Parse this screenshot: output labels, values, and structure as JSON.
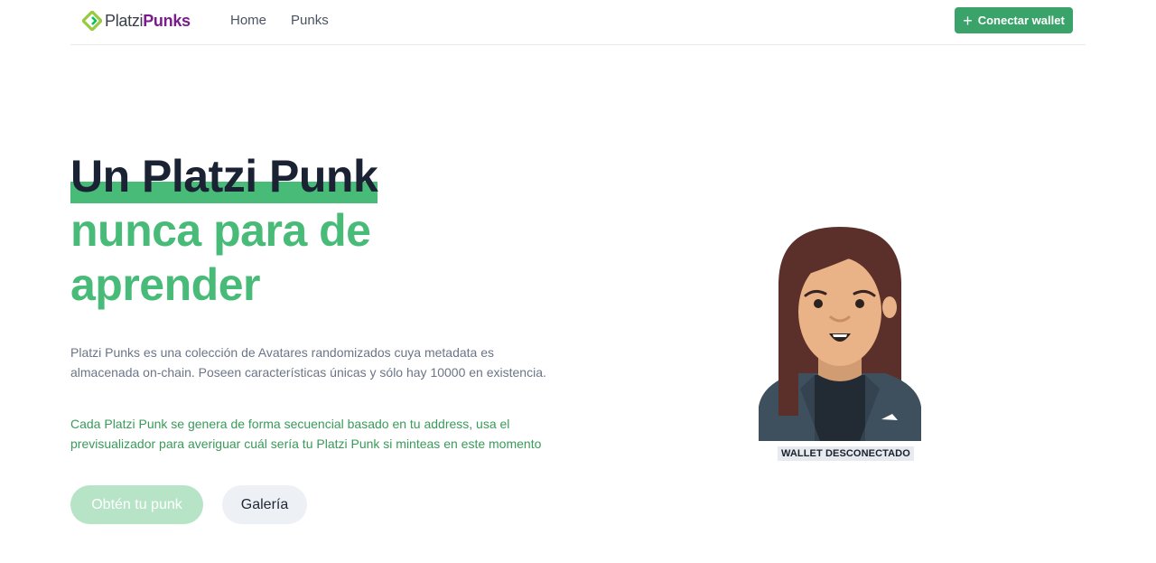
{
  "nav": {
    "logo_part1": "Platzi",
    "logo_part2": "Punks",
    "links": [
      "Home",
      "Punks"
    ],
    "connect_button": "Conectar wallet"
  },
  "hero": {
    "title_line1": "Un Platzi Punk",
    "title_line2": "nunca para de",
    "title_line3": "aprender",
    "description": "Platzi Punks es una colección de Avatares randomizados cuya metadata es almacenada on-chain. Poseen características únicas y sólo hay 10000 en existencia.",
    "info": "Cada Platzi Punk se genera de forma secuencial basado en tu address, usa el previsualizador para averiguar cuál sería tu Platzi Punk si minteas en este momento",
    "primary_button": "Obtén tu punk",
    "secondary_button": "Galería"
  },
  "avatar": {
    "status_label": "WALLET DESCONECTADO"
  },
  "colors": {
    "accent": "#48bb78",
    "logo_green": "#98ca3f",
    "logo_purple": "#7a1b8e",
    "button_green": "#3aa36a"
  }
}
